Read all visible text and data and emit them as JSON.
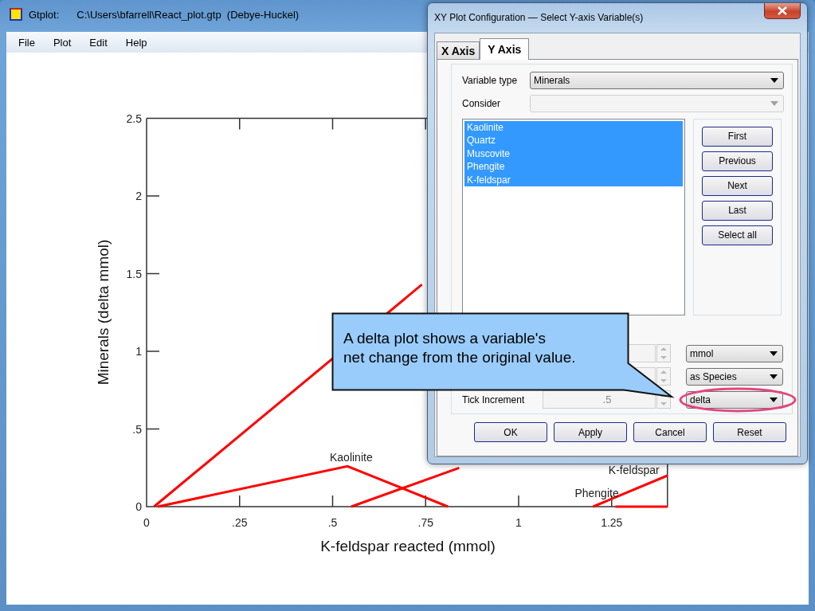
{
  "window": {
    "app": "Gtplot:",
    "file": "C:\\Users\\bfarrell\\React_plot.gtp  (Debye-Huckel)"
  },
  "menu": [
    {
      "label": "File"
    },
    {
      "label": "Plot"
    },
    {
      "label": "Edit"
    },
    {
      "label": "Help"
    }
  ],
  "plot": {
    "chart_data": {
      "type": "line",
      "xlabel": "K-feldspar reacted (mmol)",
      "ylabel": "Minerals (delta mmol)",
      "x": [
        0.02,
        0.03,
        0.54,
        0.55,
        0.74,
        0.81,
        0.84,
        1.2,
        1.26,
        1.4
      ],
      "series": [
        {
          "color": "#ff0000",
          "values": [
            0,
            null,
            null,
            null,
            1.43,
            null,
            null,
            null,
            null,
            null
          ]
        },
        {
          "color": "#ff0000",
          "values": [
            null,
            0,
            0.26,
            null,
            null,
            0,
            null,
            null,
            null,
            null
          ]
        },
        {
          "color": "#ff0000",
          "values": [
            null,
            null,
            null,
            0,
            null,
            null,
            0.25,
            null,
            null,
            null
          ]
        },
        {
          "color": "#ff0000",
          "values": [
            null,
            null,
            null,
            null,
            null,
            null,
            null,
            0,
            null,
            0.2
          ]
        },
        {
          "color": "#ff0000",
          "values": [
            null,
            null,
            null,
            null,
            null,
            null,
            null,
            null,
            0,
            0
          ]
        }
      ],
      "xlim": [
        0,
        1.4
      ],
      "ylim": [
        0,
        2.5
      ],
      "xticks": [
        0,
        {
          "value": 0.25,
          "label": ".25"
        },
        {
          "value": 0.5,
          "label": ".5"
        },
        {
          "value": 0.75,
          "label": ".75"
        },
        1,
        1.25
      ],
      "yticks": [
        0,
        {
          "value": 0.5,
          "label": ".5"
        },
        1,
        1.5,
        2,
        2.5
      ],
      "annotations": [
        "Kaolinite",
        "K-feldspar",
        "Phengite"
      ]
    }
  },
  "dialog": {
    "title": "XY Plot Configuration — Select Y-axis Variable(s)",
    "tabs": [
      {
        "label": "X Axis",
        "selected": false
      },
      {
        "label": "Y Axis",
        "selected": true
      }
    ],
    "variable_type": {
      "label": "Variable type",
      "value": "Minerals"
    },
    "consider": {
      "label": "Consider",
      "disabled": true
    },
    "variables": [
      {
        "label": "Kaolinite",
        "selected": true
      },
      {
        "label": "Quartz",
        "selected": true
      },
      {
        "label": "Muscovite",
        "selected": true
      },
      {
        "label": "Phengite",
        "selected": true
      },
      {
        "label": "K-feldspar",
        "selected": true
      }
    ],
    "nav_buttons": [
      "First",
      "Previous",
      "Next",
      "Last",
      "Select all"
    ],
    "axis_rows": [
      {
        "dropdown": "mmol",
        "highlighted": false
      },
      {
        "dropdown": "as Species",
        "highlighted": false
      },
      {
        "label": "Tick Increment",
        "value": ".5",
        "dropdown": "delta",
        "highlighted": true
      }
    ],
    "actions": [
      "OK",
      "Apply",
      "Cancel",
      "Reset"
    ]
  },
  "callout": {
    "lines": [
      "A delta plot shows a variable's",
      "net change from the original value."
    ]
  }
}
